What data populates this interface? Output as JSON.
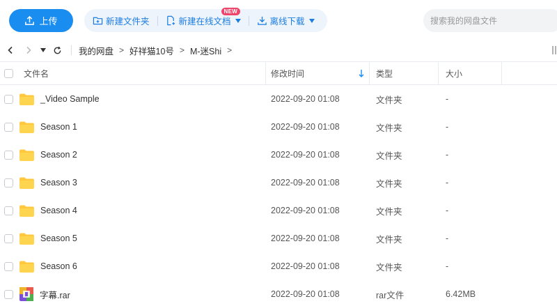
{
  "toolbar": {
    "upload_label": "上传",
    "new_folder_label": "新建文件夹",
    "new_online_doc_label": "新建在线文档",
    "new_badge": "NEW",
    "offline_download_label": "离线下载",
    "search_placeholder": "搜索我的网盘文件"
  },
  "breadcrumb": {
    "items": [
      "我的网盘",
      "好祥猫10号",
      "M-迷Shi"
    ],
    "separator": ">"
  },
  "columns": {
    "name": "文件名",
    "modified": "修改时间",
    "type": "类型",
    "size": "大小"
  },
  "files": [
    {
      "name": "_Video Sample",
      "modified": "2022-09-20 01:08",
      "type": "文件夹",
      "size": "-",
      "icon": "folder-icon"
    },
    {
      "name": "Season 1",
      "modified": "2022-09-20 01:08",
      "type": "文件夹",
      "size": "-",
      "icon": "folder-icon"
    },
    {
      "name": "Season 2",
      "modified": "2022-09-20 01:08",
      "type": "文件夹",
      "size": "-",
      "icon": "folder-icon"
    },
    {
      "name": "Season 3",
      "modified": "2022-09-20 01:08",
      "type": "文件夹",
      "size": "-",
      "icon": "folder-icon"
    },
    {
      "name": "Season 4",
      "modified": "2022-09-20 01:08",
      "type": "文件夹",
      "size": "-",
      "icon": "folder-icon"
    },
    {
      "name": "Season 5",
      "modified": "2022-09-20 01:08",
      "type": "文件夹",
      "size": "-",
      "icon": "folder-icon"
    },
    {
      "name": "Season 6",
      "modified": "2022-09-20 01:08",
      "type": "文件夹",
      "size": "-",
      "icon": "folder-icon"
    },
    {
      "name": "字幕.rar",
      "modified": "2022-09-20 01:08",
      "type": "rar文件",
      "size": "6.42MB",
      "icon": "rar-file-icon"
    }
  ],
  "colors": {
    "accent": "#1a8df0",
    "accent_text": "#1a7ce0",
    "action_bg": "#eef4fc",
    "badge": "#f0456b",
    "folder": "#ffc83d"
  }
}
